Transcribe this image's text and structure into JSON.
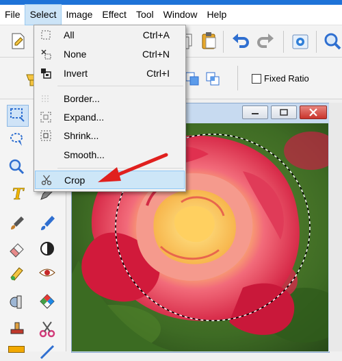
{
  "menubar": {
    "items": [
      "File",
      "Select",
      "Image",
      "Effect",
      "Tool",
      "Window",
      "Help"
    ],
    "active": "Select"
  },
  "select_menu": {
    "items": [
      {
        "label": "All",
        "shortcut": "Ctrl+A",
        "icon": "select-all-icon"
      },
      {
        "label": "None",
        "shortcut": "Ctrl+N",
        "icon": "select-none-icon"
      },
      {
        "label": "Invert",
        "shortcut": "Ctrl+I",
        "icon": "invert-selection-icon"
      },
      {
        "label": "Border...",
        "shortcut": "",
        "icon": "border-icon"
      },
      {
        "label": "Expand...",
        "shortcut": "",
        "icon": "expand-icon"
      },
      {
        "label": "Shrink...",
        "shortcut": "",
        "icon": "shrink-icon"
      },
      {
        "label": "Smooth...",
        "shortcut": "",
        "icon": "smooth-icon"
      },
      {
        "label": "Crop",
        "shortcut": "",
        "icon": "crop-scissors-icon"
      }
    ],
    "highlighted": "Crop"
  },
  "options_bar": {
    "fixed_ratio_label": "Fixed Ratio",
    "fixed_ratio_checked": false
  },
  "annotation": {
    "type": "red-arrow",
    "points_to": "Crop",
    "color": "#e0201e"
  },
  "colors": {
    "accent": "#1e73d8",
    "menu_highlight": "#cde6f7",
    "arrow": "#e0201e",
    "close_button": "#d9534f"
  },
  "canvas_image": {
    "subject": "red-and-yellow-rose",
    "selection": "elliptical-marquee"
  }
}
